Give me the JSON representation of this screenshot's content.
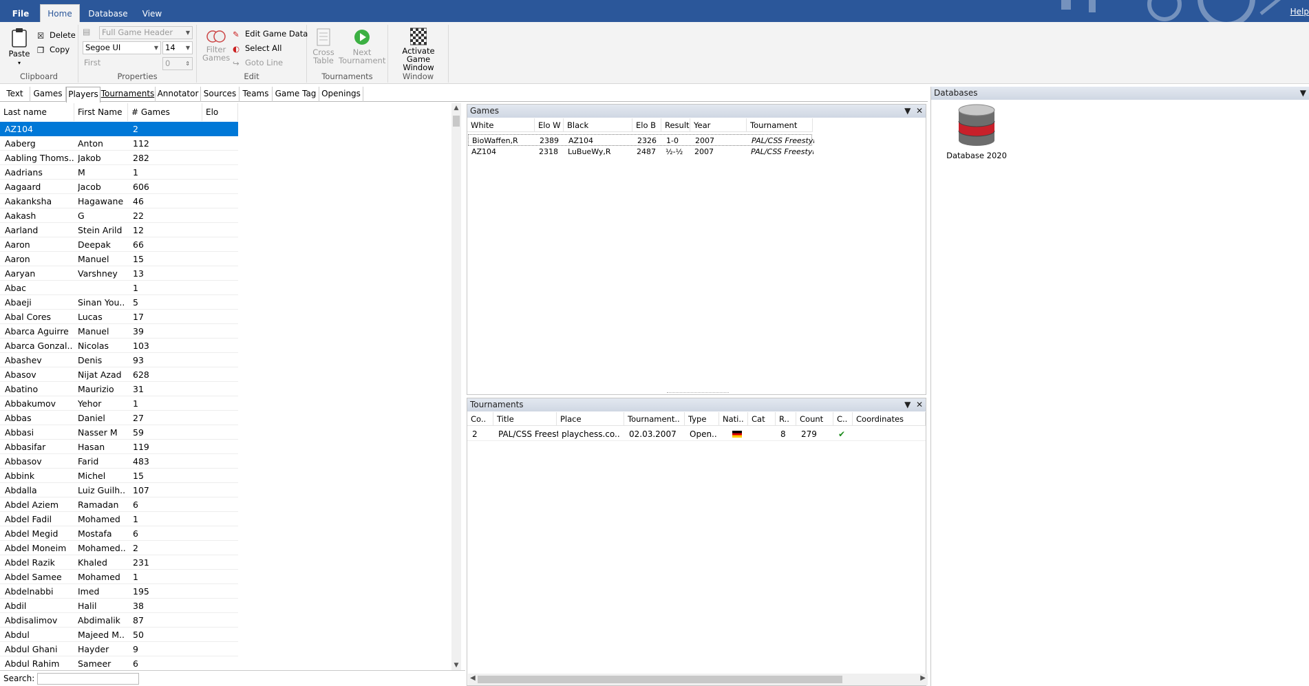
{
  "ribbon_tabs": [
    "File",
    "Home",
    "Database",
    "View"
  ],
  "help_label": "Help",
  "ribbon": {
    "clipboard": {
      "paste": "Paste",
      "delete": "Delete",
      "copy": "Copy",
      "label": "Clipboard"
    },
    "properties": {
      "header_combo": "Full Game Header",
      "font_combo": "Segoe UI",
      "size_combo": "14",
      "first_label": "First",
      "first_value": "0",
      "label": "Properties"
    },
    "edit": {
      "filter_line1": "Filter",
      "filter_line2": "Games",
      "edit_game_data": "Edit Game Data",
      "select_all": "Select All",
      "goto_line": "Goto Line",
      "label": "Edit"
    },
    "tournaments": {
      "cross_line1": "Cross",
      "cross_line2": "Table",
      "next_line1": "Next",
      "next_line2": "Tournament",
      "label": "Tournaments"
    },
    "window": {
      "activate_line1": "Activate Game",
      "activate_line2": "Window",
      "label": "Window"
    }
  },
  "content_tabs": [
    "Text",
    "Games",
    "Players",
    "Tournaments",
    "Annotator",
    "Sources",
    "Teams",
    "Game Tag",
    "Openings"
  ],
  "players": {
    "columns": [
      "Last name",
      "First Name",
      "# Games",
      "Elo"
    ],
    "rows": [
      [
        "AZ104",
        "",
        "2"
      ],
      [
        "Aaberg",
        "Anton",
        "112"
      ],
      [
        "Aabling Thoms..",
        "Jakob",
        "282"
      ],
      [
        "Aadrians",
        "M",
        "1"
      ],
      [
        "Aagaard",
        "Jacob",
        "606"
      ],
      [
        "Aakanksha",
        "Hagawane",
        "46"
      ],
      [
        "Aakash",
        "G",
        "22"
      ],
      [
        "Aarland",
        "Stein Arild",
        "12"
      ],
      [
        "Aaron",
        "Deepak",
        "66"
      ],
      [
        "Aaron",
        "Manuel",
        "15"
      ],
      [
        "Aaryan",
        "Varshney",
        "13"
      ],
      [
        "Abac",
        "",
        "1"
      ],
      [
        "Abaeji",
        "Sinan You..",
        "5"
      ],
      [
        "Abal Cores",
        "Lucas",
        "17"
      ],
      [
        "Abarca Aguirre",
        "Manuel",
        "39"
      ],
      [
        "Abarca Gonzal..",
        "Nicolas",
        "103"
      ],
      [
        "Abashev",
        "Denis",
        "93"
      ],
      [
        "Abasov",
        "Nijat Azad",
        "628"
      ],
      [
        "Abatino",
        "Maurizio",
        "31"
      ],
      [
        "Abbakumov",
        "Yehor",
        "1"
      ],
      [
        "Abbas",
        "Daniel",
        "27"
      ],
      [
        "Abbasi",
        "Nasser M",
        "59"
      ],
      [
        "Abbasifar",
        "Hasan",
        "119"
      ],
      [
        "Abbasov",
        "Farid",
        "483"
      ],
      [
        "Abbink",
        "Michel",
        "15"
      ],
      [
        "Abdalla",
        "Luiz Guilh..",
        "107"
      ],
      [
        "Abdel Aziem",
        "Ramadan",
        "6"
      ],
      [
        "Abdel Fadil",
        "Mohamed",
        "1"
      ],
      [
        "Abdel Megid",
        "Mostafa",
        "6"
      ],
      [
        "Abdel Moneim",
        "Mohamed..",
        "2"
      ],
      [
        "Abdel Razik",
        "Khaled",
        "231"
      ],
      [
        "Abdel Samee",
        "Mohamed",
        "1"
      ],
      [
        "Abdelnabbi",
        "Imed",
        "195"
      ],
      [
        "Abdil",
        "Halil",
        "38"
      ],
      [
        "Abdisalimov",
        "Abdimalik",
        "87"
      ],
      [
        "Abdul",
        "Majeed M..",
        "50"
      ],
      [
        "Abdul Ghani",
        "Hayder",
        "9"
      ],
      [
        "Abdul Rahim",
        "Sameer",
        "6"
      ]
    ]
  },
  "search": {
    "label": "Search:",
    "value": ""
  },
  "games_panel": {
    "title": "Games",
    "columns": [
      "White",
      "Elo W",
      "Black",
      "Elo B",
      "Result",
      "Year",
      "Tournament"
    ],
    "rows": [
      [
        "BioWaffen,R",
        "2389",
        "AZ104",
        "2326",
        "1-0",
        "2007",
        "PAL/CSS Freestyl.."
      ],
      [
        "AZ104",
        "2318",
        "LuBueWy,R",
        "2487",
        "½-½",
        "2007",
        "PAL/CSS Freestyl.."
      ]
    ]
  },
  "tournaments_panel": {
    "title": "Tournaments",
    "columns": [
      "Co..",
      "Title",
      "Place",
      "Tournament..",
      "Type",
      "Nati..",
      "Cat",
      "R..",
      "Count",
      "C..",
      "Coordinates"
    ],
    "rows": [
      [
        "2",
        "PAL/CSS Freest..",
        "playchess.co..",
        "02.03.2007",
        "Open..",
        "",
        "",
        "8",
        "279",
        "",
        ""
      ]
    ]
  },
  "databases_panel": {
    "title": "Databases",
    "item": "Database 2020"
  },
  "colors": {
    "title_bar": "#2b579a",
    "selection": "#0078d7",
    "ribbon": "#f3f3f3"
  }
}
